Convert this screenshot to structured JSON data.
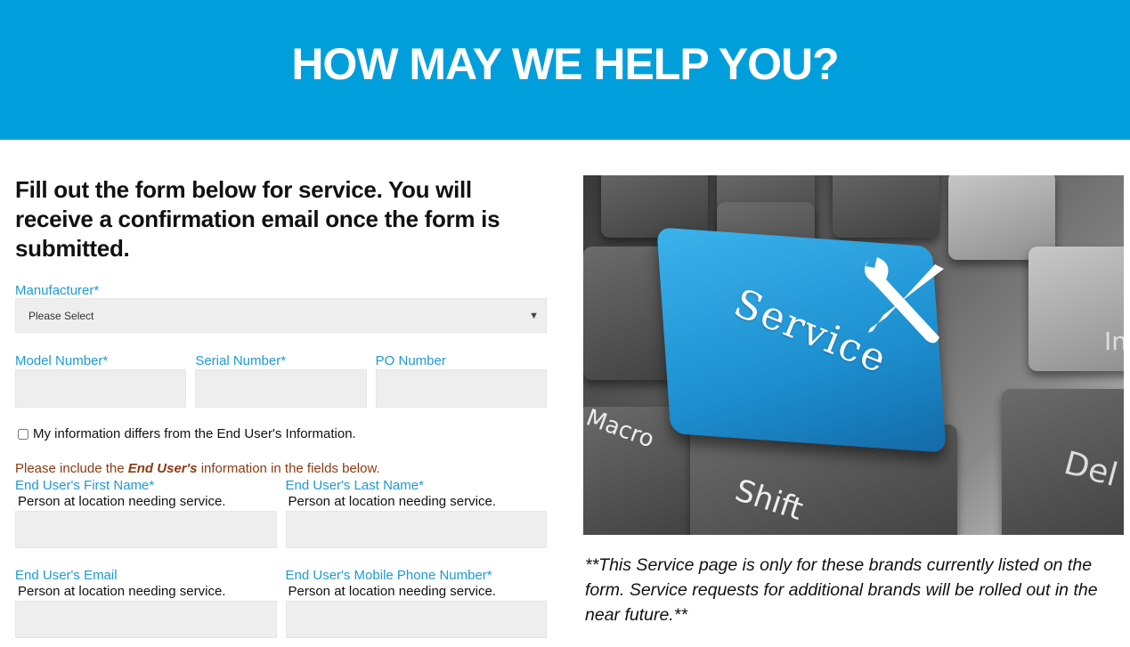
{
  "hero": {
    "title": "HOW MAY WE HELP YOU?",
    "background": "#009fdb"
  },
  "form": {
    "intro": "Fill out the form below for service. You will receive a confirmation email once the form is submitted.",
    "manufacturer": {
      "label": "Manufacturer*",
      "selected": "Please Select"
    },
    "model_number": {
      "label": "Model Number*",
      "value": ""
    },
    "serial_number": {
      "label": "Serial Number*",
      "value": ""
    },
    "po_number": {
      "label": "PO Number",
      "value": ""
    },
    "differs_checkbox": {
      "label": "My information differs from the End User's Information.",
      "checked": false
    },
    "note": {
      "prefix": "Please include the ",
      "emphasis": "End User's",
      "suffix": " information in the fields below."
    },
    "end_user_first_name": {
      "label": "End User's First Name*",
      "hint": "Person at location needing service.",
      "value": ""
    },
    "end_user_last_name": {
      "label": "End User's Last Name*",
      "hint": "Person at location needing service.",
      "value": ""
    },
    "end_user_email": {
      "label": "End User's Email",
      "hint": "Person at location needing service.",
      "value": ""
    },
    "end_user_mobile": {
      "label": "End User's Mobile Phone Number*",
      "hint": "Person at location needing service.",
      "value": ""
    },
    "label_color": "#1e9ad6",
    "note_color": "#8b3b12"
  },
  "aside": {
    "image": {
      "description": "Keyboard with blue Service key",
      "key_text": "Service",
      "key_labels": [
        "Macro",
        "Shift",
        "Del",
        "In"
      ]
    },
    "disclaimer": "**This Service page is only for these brands currently listed on the form. Service requests for additional brands will be rolled out in the near future.**"
  }
}
